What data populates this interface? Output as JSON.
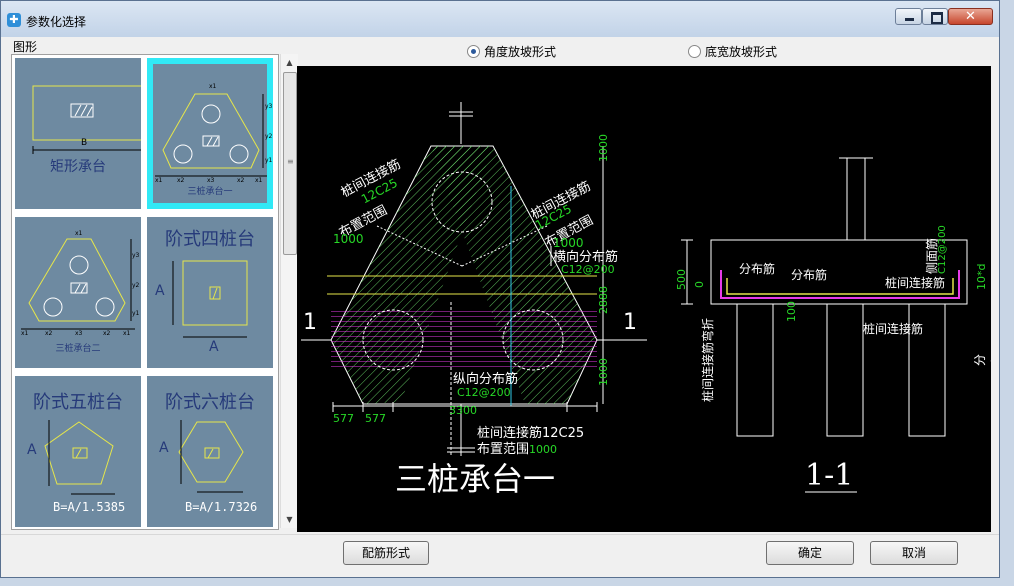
{
  "window": {
    "title": "参数化选择",
    "app_icon": "app-icon"
  },
  "left_panel": {
    "group_label": "图形",
    "thumbnails": [
      {
        "caption": "矩形承台",
        "dim": "B",
        "selected": false
      },
      {
        "caption": "三桩承台一",
        "selected": true
      },
      {
        "caption": "三桩承台二",
        "selected": false
      },
      {
        "caption": "阶式四桩台",
        "dim_a": "A",
        "dim_b": "A",
        "selected": false
      },
      {
        "caption": "阶式五桩台",
        "dim_a": "A",
        "formula": "B=A/1.5385",
        "selected": false
      },
      {
        "caption": "阶式六桩台",
        "dim_a": "A",
        "formula": "B=A/1.7326",
        "selected": false
      }
    ]
  },
  "options": {
    "radio_angle": {
      "label": "角度放坡形式",
      "checked": true
    },
    "radio_width": {
      "label": "底宽放坡形式",
      "checked": false
    }
  },
  "drawing": {
    "title": "三桩承台一",
    "section_title": "1-1",
    "section_marks": [
      "1",
      "1"
    ],
    "labels": {
      "pile_link_bar_left": "桩间连接筋",
      "pile_link_bar_left_spec": "12C25",
      "layout_range_left": "布置范围",
      "layout_range_left_val": "1000",
      "pile_link_bar_right": "桩间连接筋",
      "pile_link_bar_right_spec": "12C25",
      "layout_range_right": "布置范围",
      "layout_range_right_val": "1000",
      "transverse_bar": "横向分布筋",
      "transverse_bar_spec": "C12@200",
      "longitudinal_bar": "纵向分布筋",
      "longitudinal_bar_spec": "C12@200",
      "bottom_link_bar": "桩间连接筋12C25",
      "bottom_layout": "布置范围",
      "bottom_layout_val": "1000",
      "dim_1000_top": "1000",
      "dim_2888": "2888",
      "dim_1000_bottom": "1000",
      "dim_577a": "577",
      "dim_577b": "577",
      "dim_3300": "3300"
    },
    "section_labels": {
      "dist_bar_1": "分布筋",
      "dist_bar_2": "分布筋",
      "side_bar": "侧面筋",
      "side_bar_spec": "C12@200",
      "link_bar_1": "桩间连接筋",
      "link_bar_2": "桩间连接筋",
      "pile_bend": "桩间连接筋弯折",
      "dist_bend": "分布筋弯折",
      "dim_500": "500",
      "dim_0": "0",
      "dim_100": "100",
      "dim_10d": "10*d"
    }
  },
  "buttons": {
    "rebar_form": "配筋形式",
    "ok": "确定",
    "cancel": "取消"
  },
  "colors": {
    "selection": "#31e9f6",
    "thumb_bg": "#6e8aa1",
    "dim_green": "#27d827",
    "hatch_green": "#6fe26f",
    "magenta": "#e83be8",
    "yellow": "#e6e64a"
  }
}
